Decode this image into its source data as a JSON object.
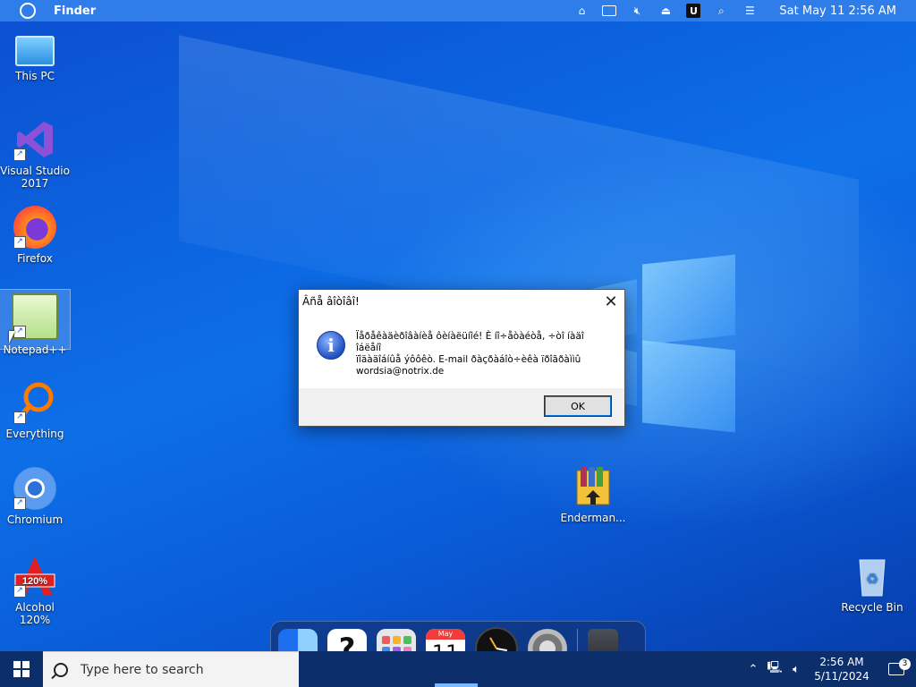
{
  "menubar": {
    "app_name": "Finder",
    "u_label": "U",
    "clock": "Sat May 11  2:56 AM"
  },
  "desktop_icons": [
    {
      "label": "This PC"
    },
    {
      "label": "Visual Studio 2017"
    },
    {
      "label": "Firefox"
    },
    {
      "label": "Notepad++"
    },
    {
      "label": "Everything"
    },
    {
      "label": "Chromium"
    },
    {
      "label": "Alcohol 120%"
    },
    {
      "label": "Enderman..."
    },
    {
      "label": "Recycle Bin"
    }
  ],
  "alcohol_badge": "120%",
  "dialog": {
    "title": "Âñå âîòîâî!",
    "message_line1": "Ïåðåêàäèðîâàíèå ôèíàëüíîé! È íî÷åòàéòå, ÷òî íàäî îáëåíî",
    "message_line2": "ïîäàäîáíûå ýôôêò. E-mail ðàçðàáîò÷èêà ïðîãðàììû",
    "message_line3": "wordsia@notrix.de",
    "ok_label": "OK"
  },
  "dock": {
    "help_glyph": "?",
    "calendar_month": "May",
    "calendar_day": "11"
  },
  "taskbar": {
    "search_placeholder": "Type here to search",
    "time": "2:56 AM",
    "date": "5/11/2024",
    "notification_count": "3"
  }
}
